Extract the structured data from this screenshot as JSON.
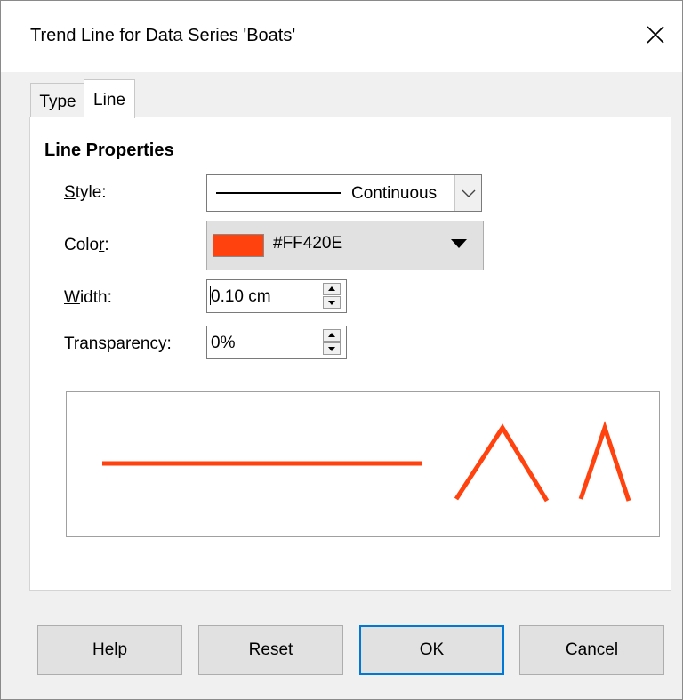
{
  "dialog": {
    "title": "Trend Line for Data Series 'Boats'",
    "close_symbol": "✕"
  },
  "tabs": [
    {
      "label": "Type",
      "active": false
    },
    {
      "label": "Line",
      "active": true
    }
  ],
  "line_properties": {
    "section_title": "Line Properties",
    "style": {
      "label_underlined": "S",
      "label_rest": "tyle:",
      "value": "Continuous"
    },
    "color": {
      "label_pre": "Colo",
      "label_underlined": "r",
      "label_post": ":",
      "value": "#FF420E",
      "swatch_color": "#FF420E"
    },
    "width": {
      "label_underlined": "W",
      "label_rest": "idth:",
      "value": "0.10 cm"
    },
    "transparency": {
      "label_underlined": "T",
      "label_rest": "ransparency:",
      "value": "0%"
    }
  },
  "preview": {
    "line_color": "#FF420E"
  },
  "buttons": {
    "help": {
      "underlined": "H",
      "rest": "elp"
    },
    "reset": {
      "underlined": "R",
      "rest": "eset"
    },
    "ok": {
      "underlined": "O",
      "rest": "K"
    },
    "cancel": {
      "underlined": "C",
      "rest": "ancel"
    }
  },
  "icons": {
    "close": "close-icon",
    "dropdown": "chevron-down-icon",
    "spin": "spin-arrows-icon"
  },
  "colors": {
    "accent": "#0078D7",
    "dialog_bg": "#F0F0F0"
  }
}
